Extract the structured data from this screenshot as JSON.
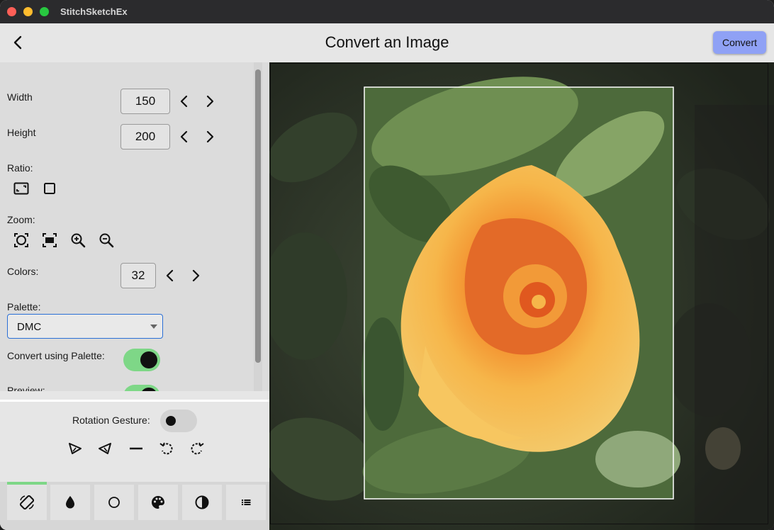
{
  "window": {
    "app_title": "StitchSketchEx"
  },
  "header": {
    "title": "Convert an Image",
    "convert_label": "Convert"
  },
  "settings": {
    "width_label": "Width",
    "width_value": "150",
    "height_label": "Height",
    "height_value": "200",
    "ratio_label": "Ratio:",
    "zoom_label": "Zoom:",
    "colors_label": "Colors:",
    "colors_value": "32",
    "palette_label": "Palette:",
    "palette_value": "DMC",
    "convert_palette_label": "Convert using Palette:",
    "convert_palette_on": true,
    "preview_label": "Preview:",
    "preview_on": true
  },
  "rotation": {
    "label": "Rotation Gesture:",
    "on": false
  },
  "tabs": [
    {
      "icon": "rotate-screen-icon",
      "selected": true
    },
    {
      "icon": "drop-icon",
      "selected": false
    },
    {
      "icon": "circle-icon",
      "selected": false
    },
    {
      "icon": "palette-icon",
      "selected": false
    },
    {
      "icon": "contrast-icon",
      "selected": false
    },
    {
      "icon": "list-icon",
      "selected": false
    }
  ],
  "colors": {
    "accent": "#8fa1f5",
    "toggle_on": "#7ed787",
    "focus": "#2a6fd6"
  }
}
